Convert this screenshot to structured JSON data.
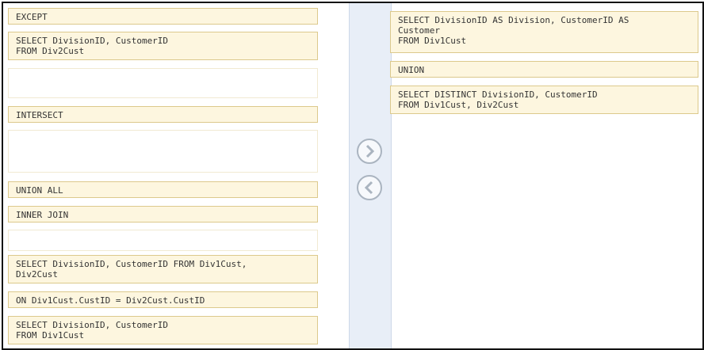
{
  "answer_area": {
    "items": [
      {
        "text": "SELECT DivisionID AS Division, CustomerID AS\nCustomer\nFROM Div1Cust"
      },
      {
        "text": "UNION"
      },
      {
        "text": "SELECT DISTINCT DivisionID, CustomerID\nFROM Div1Cust, Div2Cust"
      }
    ]
  },
  "source_list": {
    "items": [
      {
        "text": "EXCEPT"
      },
      {
        "text": "SELECT DivisionID, CustomerID\nFROM Div2Cust"
      },
      {
        "text": "INTERSECT"
      },
      {
        "text": "UNION ALL"
      },
      {
        "text": "INNER JOIN"
      },
      {
        "text": "SELECT DivisionID, CustomerID FROM Div1Cust,\nDiv2Cust"
      },
      {
        "text": "ON Div1Cust.CustID = Div2Cust.CustID"
      },
      {
        "text": "SELECT DivisionID, CustomerID\nFROM Div1Cust"
      }
    ]
  },
  "controls": {
    "move_right_icon": "chevron-right",
    "move_left_icon": "chevron-left"
  }
}
